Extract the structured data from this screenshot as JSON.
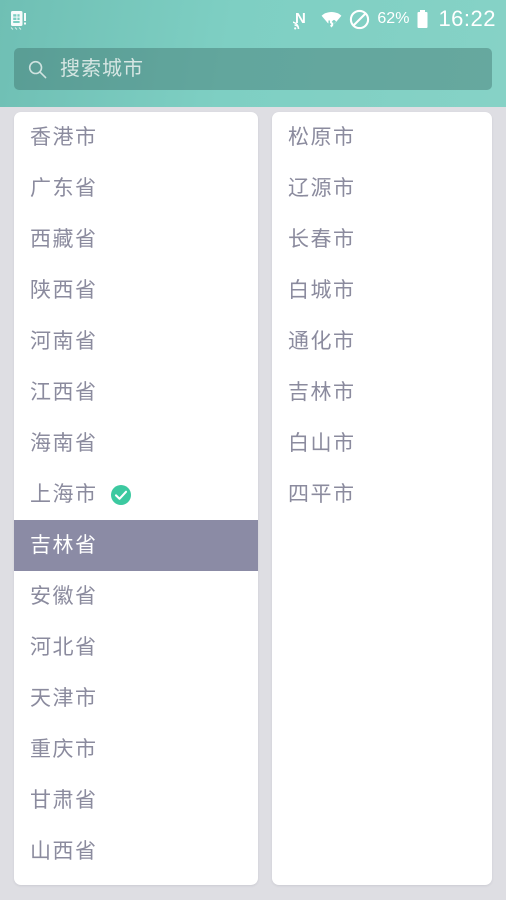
{
  "status_bar": {
    "sim_icon": "sim-card-icon",
    "nfc_icon": "nfc-icon",
    "nfc_label": "N",
    "wifi_icon": "wifi-icon",
    "dnd_icon": "do-not-disturb-icon",
    "battery_percent": "62%",
    "battery_icon": "battery-icon",
    "time": "16:22"
  },
  "search": {
    "icon": "search-icon",
    "placeholder": "搜索城市",
    "value": ""
  },
  "colors": {
    "header_teal": "#7ecfc3",
    "search_field": "#5d9490",
    "page_background": "#dedee3",
    "card_background": "#ffffff",
    "item_text": "#8b8b9e",
    "selected_background": "#8b8ba5",
    "selected_text": "#ffffff",
    "check_green": "#3cc9a0"
  },
  "province_list": {
    "items": [
      {
        "label": "香港市",
        "selected": false,
        "checked": false
      },
      {
        "label": "广东省",
        "selected": false,
        "checked": false
      },
      {
        "label": "西藏省",
        "selected": false,
        "checked": false
      },
      {
        "label": "陕西省",
        "selected": false,
        "checked": false
      },
      {
        "label": "河南省",
        "selected": false,
        "checked": false
      },
      {
        "label": "江西省",
        "selected": false,
        "checked": false
      },
      {
        "label": "海南省",
        "selected": false,
        "checked": false
      },
      {
        "label": "上海市",
        "selected": false,
        "checked": true
      },
      {
        "label": "吉林省",
        "selected": true,
        "checked": false
      },
      {
        "label": "安徽省",
        "selected": false,
        "checked": false
      },
      {
        "label": "河北省",
        "selected": false,
        "checked": false
      },
      {
        "label": "天津市",
        "selected": false,
        "checked": false
      },
      {
        "label": "重庆市",
        "selected": false,
        "checked": false
      },
      {
        "label": "甘肃省",
        "selected": false,
        "checked": false
      },
      {
        "label": "山西省",
        "selected": false,
        "checked": false
      }
    ]
  },
  "city_list": {
    "items": [
      {
        "label": "松原市",
        "selected": false,
        "checked": false
      },
      {
        "label": "辽源市",
        "selected": false,
        "checked": false
      },
      {
        "label": "长春市",
        "selected": false,
        "checked": false
      },
      {
        "label": "白城市",
        "selected": false,
        "checked": false
      },
      {
        "label": "通化市",
        "selected": false,
        "checked": false
      },
      {
        "label": "吉林市",
        "selected": false,
        "checked": false
      },
      {
        "label": "白山市",
        "selected": false,
        "checked": false
      },
      {
        "label": "四平市",
        "selected": false,
        "checked": false
      }
    ]
  }
}
